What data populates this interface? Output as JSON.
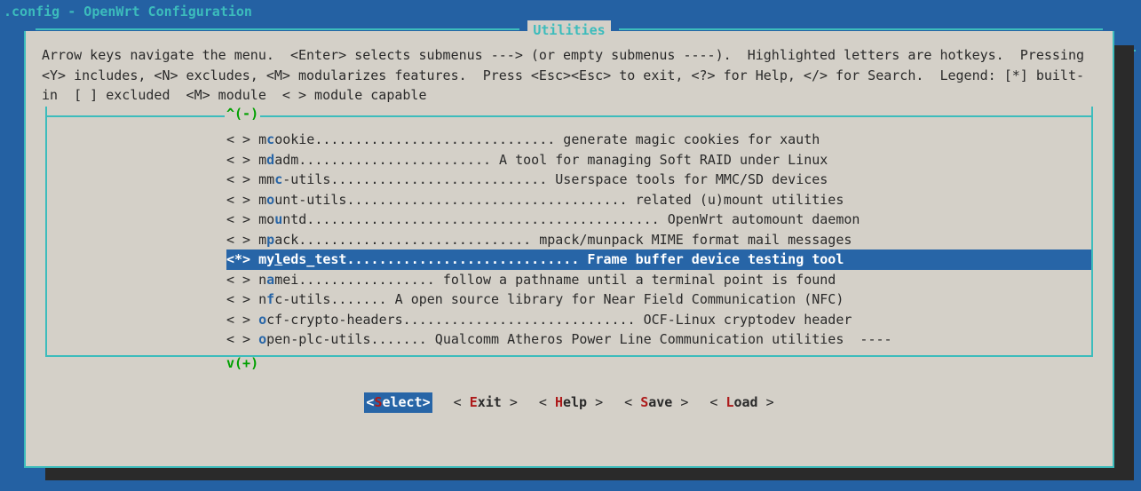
{
  "title": ".config - OpenWrt Configuration",
  "breadcrumb_prefix": "> ",
  "breadcrumb": "Utilities",
  "panel_title": "Utilities",
  "help_text": "Arrow keys navigate the menu.  <Enter> selects submenus ---> (or empty submenus ----).  Highlighted letters are hotkeys.  Pressing <Y> includes, <N> excludes, <M> modularizes features.  Press <Esc><Esc> to exit, <?> for Help, </> for Search.  Legend: [*] built-in  [ ] excluded  <M> module  < > module capable",
  "scroll_top": "^(-)",
  "scroll_bottom": "v(+)",
  "items": [
    {
      "mark": "< >",
      "pre": "m",
      "hot": "c",
      "post": "ookie.............................. generate magic cookies for xauth",
      "sel": false,
      "sub": false
    },
    {
      "mark": "< >",
      "pre": "m",
      "hot": "d",
      "post": "adm........................ A tool for managing Soft RAID under Linux",
      "sel": false,
      "sub": false
    },
    {
      "mark": "< >",
      "pre": "mm",
      "hot": "c",
      "post": "-utils........................... Userspace tools for MMC/SD devices",
      "sel": false,
      "sub": false
    },
    {
      "mark": "< >",
      "pre": "m",
      "hot": "o",
      "post": "unt-utils................................... related (u)mount utilities",
      "sel": false,
      "sub": false
    },
    {
      "mark": "< >",
      "pre": "mo",
      "hot": "u",
      "post": "ntd............................................ OpenWrt automount daemon",
      "sel": false,
      "sub": false
    },
    {
      "mark": "< >",
      "pre": "m",
      "hot": "p",
      "post": "ack............................. mpack/munpack MIME format mail messages",
      "sel": false,
      "sub": false
    },
    {
      "mark": "<*>",
      "pre": "my",
      "hot": "l",
      "post": "eds_test............................. Frame buffer device testing tool",
      "sel": true,
      "sub": false
    },
    {
      "mark": "< >",
      "pre": "n",
      "hot": "a",
      "post": "mei................. follow a pathname until a terminal point is found",
      "sel": false,
      "sub": false
    },
    {
      "mark": "< >",
      "pre": "n",
      "hot": "f",
      "post": "c-utils....... A open source library for Near Field Communication (NFC)",
      "sel": false,
      "sub": false
    },
    {
      "mark": "< >",
      "pre": "",
      "hot": "o",
      "post": "cf-crypto-headers............................. OCF-Linux cryptodev header",
      "sel": false,
      "sub": false
    },
    {
      "mark": "< >",
      "pre": "",
      "hot": "o",
      "post": "pen-plc-utils....... Qualcomm Atheros Power Line Communication utilities",
      "sel": false,
      "sub": true
    }
  ],
  "submenu_indicator": "  ----",
  "buttons": [
    {
      "label": "Select",
      "hot": "S",
      "active": true
    },
    {
      "label": "Exit",
      "hot": "E",
      "active": false
    },
    {
      "label": "Help",
      "hot": "H",
      "active": false
    },
    {
      "label": "Save",
      "hot": "S",
      "active": false
    },
    {
      "label": "Load",
      "hot": "L",
      "active": false
    }
  ]
}
